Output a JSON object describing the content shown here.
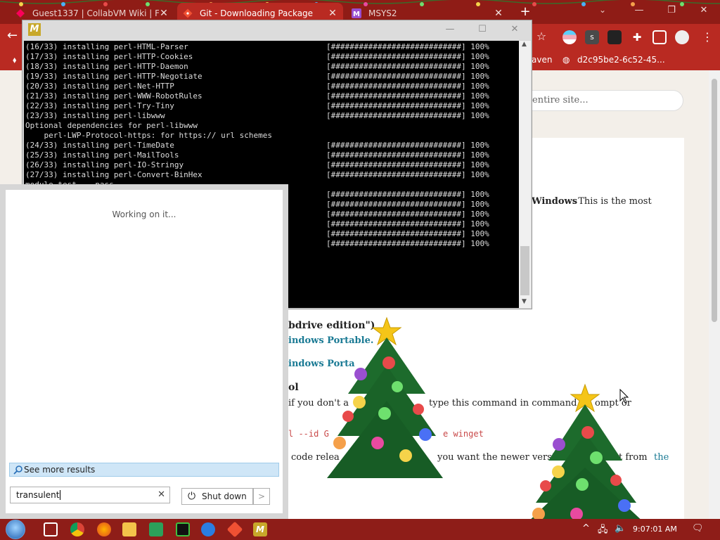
{
  "browser": {
    "tabs": [
      {
        "label": "Guest1337 | CollabVM Wiki | Fa",
        "close": "✕"
      },
      {
        "label": "Git - Downloading Package",
        "close": "✕"
      },
      {
        "label": "MSYS2",
        "close": "✕"
      }
    ],
    "new_tab": "+",
    "bookmarks": [
      {
        "label": "aven"
      },
      {
        "label": "d2c95be2-6c52-45..."
      }
    ]
  },
  "page": {
    "search_placeholder": "entire site...",
    "fragments": {
      "windows_bold": "Windows",
      "windows_rest": ". This is the most",
      "heading_edition": "bdrive edition\")",
      "link_portable1": "indows Portable.",
      "link_portable2": "indows Porta",
      "heading_ol": "ol",
      "para_dont": "if you don't a",
      "para_type": "type this command in command pr",
      "para_ompt": "ompt or",
      "code_winget": "l --id G",
      "code_winget2": "e winget",
      "para_code": "code relea",
      "para_newer": "you want the newer version",
      "para_from": "t from",
      "link_the": "the"
    }
  },
  "console": {
    "title_icon": "M",
    "lines": [
      {
        "text": "(16/33) installing perl-HTML-Parser",
        "bar": "[############################] 100%"
      },
      {
        "text": "(17/33) installing perl-HTTP-Cookies",
        "bar": "[############################] 100%"
      },
      {
        "text": "(18/33) installing perl-HTTP-Daemon",
        "bar": "[############################] 100%"
      },
      {
        "text": "(19/33) installing perl-HTTP-Negotiate",
        "bar": "[############################] 100%"
      },
      {
        "text": "(20/33) installing perl-Net-HTTP",
        "bar": "[############################] 100%"
      },
      {
        "text": "(21/33) installing perl-WWW-RobotRules",
        "bar": "[############################] 100%"
      },
      {
        "text": "(22/33) installing perl-Try-Tiny",
        "bar": "[############################] 100%"
      },
      {
        "text": "(23/33) installing perl-libwww",
        "bar": "[############################] 100%"
      },
      {
        "text": "Optional dependencies for perl-libwww",
        "bar": ""
      },
      {
        "text": "    perl-LWP-Protocol-https: for https:// url schemes",
        "bar": ""
      },
      {
        "text": "(24/33) installing perl-TimeDate",
        "bar": "[############################] 100%"
      },
      {
        "text": "(25/33) installing perl-MailTools",
        "bar": "[############################] 100%"
      },
      {
        "text": "(26/33) installing perl-IO-Stringy",
        "bar": "[############################] 100%"
      },
      {
        "text": "(27/33) installing perl-Convert-BinHex",
        "bar": "[############################] 100%"
      },
      {
        "text": "module test... pass.",
        "bar": ""
      },
      {
        "text": "",
        "bar": "[############################] 100%"
      },
      {
        "text": "",
        "bar": "[############################] 100%"
      },
      {
        "text": "",
        "bar": "[############################] 100%"
      },
      {
        "text": "",
        "bar": "[############################] 100%"
      },
      {
        "text": "",
        "bar": "[############################] 100%"
      },
      {
        "text": "",
        "bar": "[############################] 100%"
      }
    ]
  },
  "start_menu": {
    "status": "Working on it...",
    "see_more": "See more results",
    "search_value": "transulent",
    "clear": "✕",
    "shutdown": "Shut down",
    "shutdown_arrow": ">"
  },
  "taskbar": {
    "clock": "9:07:01 AM"
  }
}
